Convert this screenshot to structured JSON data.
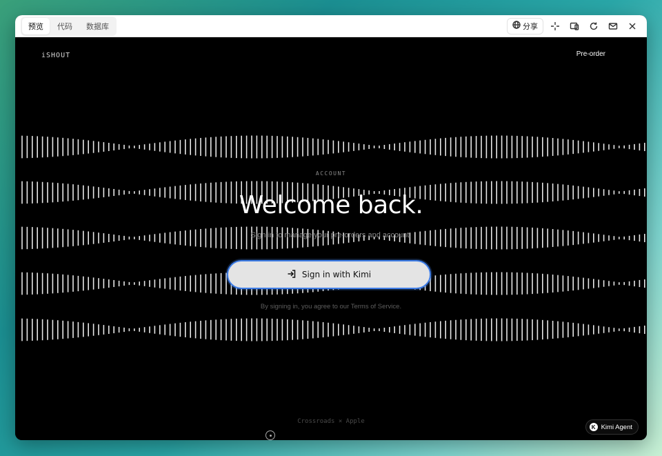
{
  "titlebar": {
    "tabs": [
      {
        "label": "预览",
        "active": true
      },
      {
        "label": "代码",
        "active": false
      },
      {
        "label": "数据库",
        "active": false
      }
    ],
    "share_label": "分享"
  },
  "site": {
    "brand": "iSHOUT",
    "nav_preorder": "Pre-order"
  },
  "hero": {
    "eyebrow": "ACCOUNT",
    "headline": "Welcome back.",
    "subtitle": "Sign in to manage your pre-orders and account.",
    "signin_label": "Sign in with Kimi",
    "terms": "By signing in, you agree to our Terms of Service."
  },
  "footer_note": "Crossroads × Apple",
  "agent_badge": {
    "logo": "K",
    "label": "Kimi Agent"
  },
  "colors": {
    "accent": "#3f7ee8",
    "background": "#000000",
    "button": "#e4e4e4"
  }
}
